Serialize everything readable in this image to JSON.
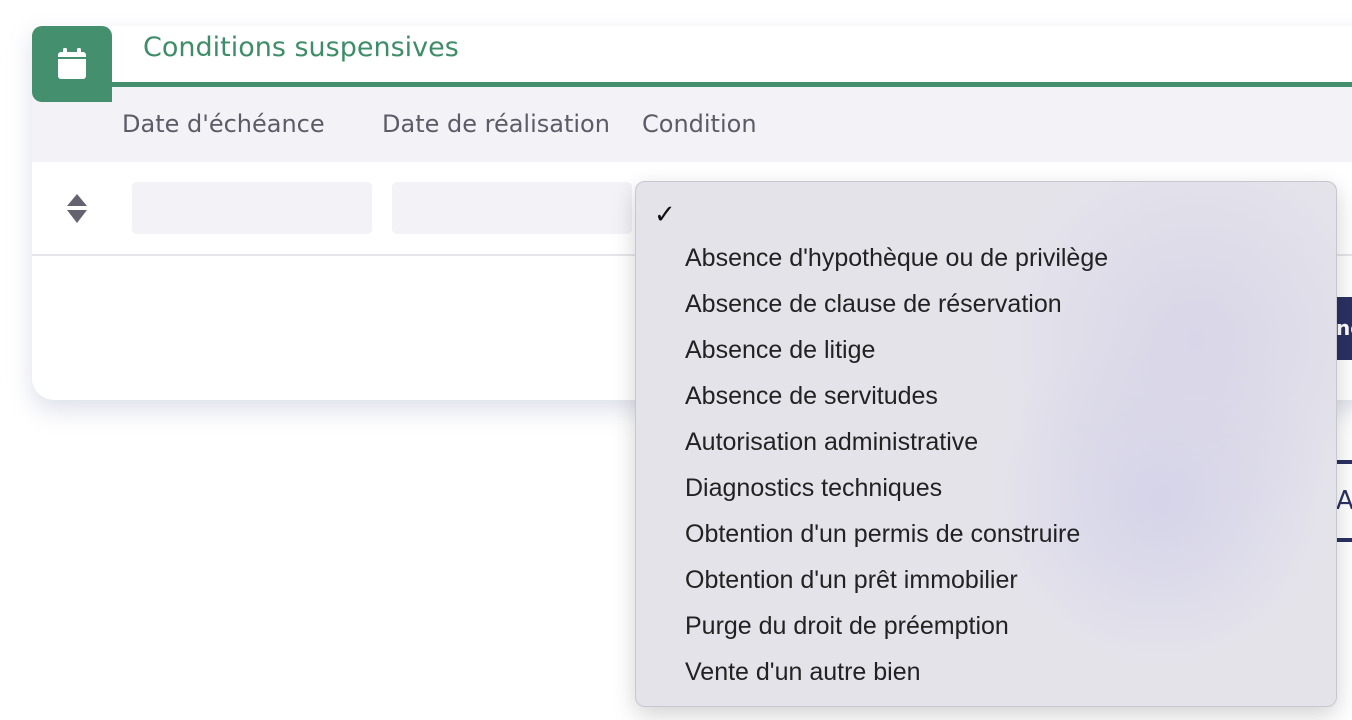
{
  "section": {
    "title": "Conditions suspensives",
    "icon": "calendar-icon"
  },
  "table": {
    "headers": [
      "Date d'échéance",
      "Date de réalisation",
      "Condition"
    ]
  },
  "dropdown": {
    "selected": "",
    "check_icon": "checkmark-icon",
    "options": [
      "Absence d'hypothèque ou de privilège",
      "Absence de clause de réservation",
      "Absence de litige",
      "Absence de servitudes",
      "Autorisation administrative",
      "Diagnostics techniques",
      "Obtention d'un permis de construire",
      "Obtention d'un prêt immobilier",
      "Purge du droit de préemption",
      "Vente d'un autre bien"
    ]
  },
  "partial": {
    "button_fragment": "ne",
    "outlined_fragment": "A"
  },
  "colors": {
    "accent": "#438f6e",
    "navy": "#2b3263"
  }
}
